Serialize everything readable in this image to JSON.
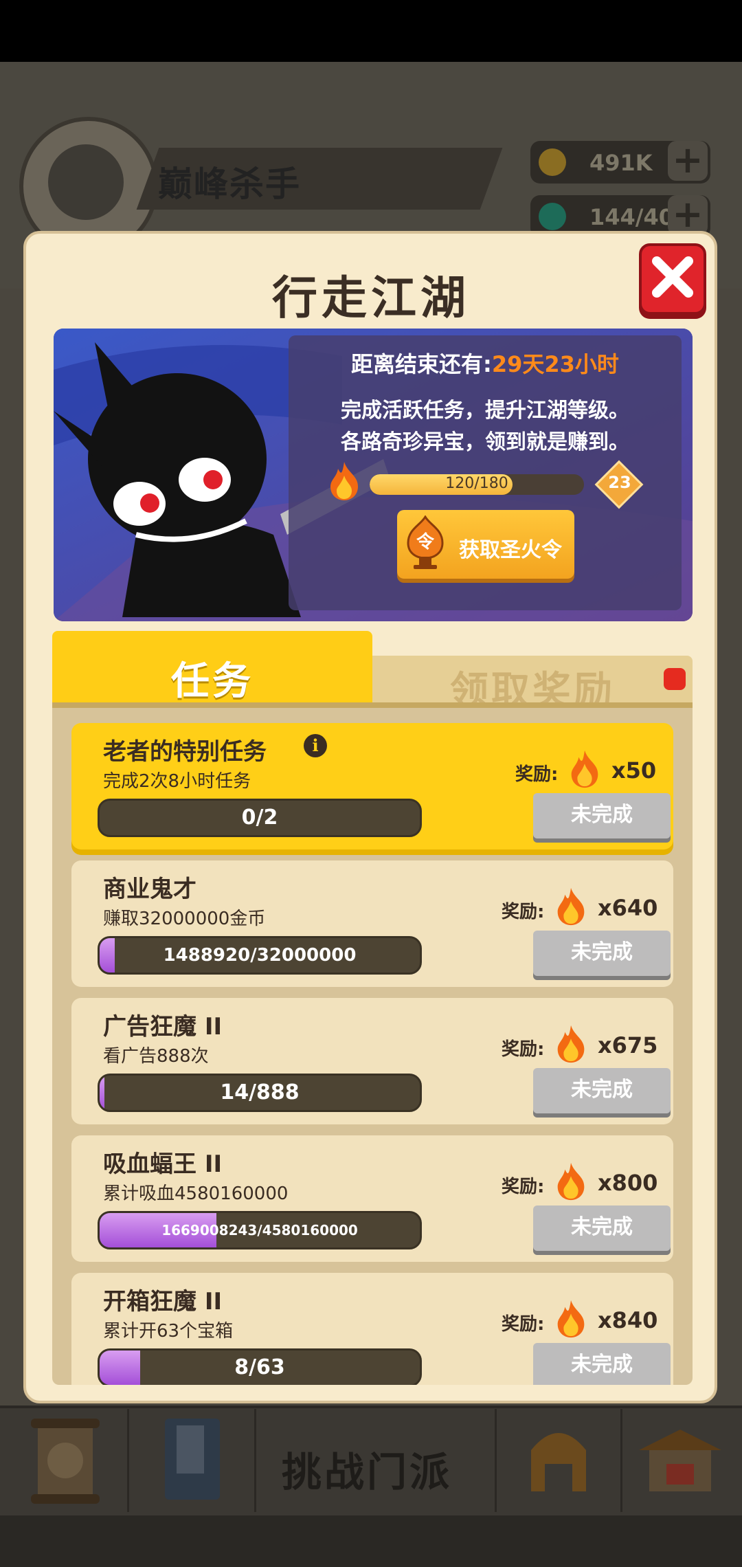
{
  "background": {
    "player_name": "巅峰杀手",
    "gold": "491K",
    "energy": "144/40",
    "plus": "+",
    "nav_challenge": "挑战门派"
  },
  "modal": {
    "title": "行走江湖",
    "banner": {
      "countdown_label": "距离结束还有:",
      "countdown_value": "29天23小时",
      "desc_line1": "完成活跃任务，提升江湖等级。",
      "desc_line2": "各路奇珍异宝，领到就是赚到。",
      "progress_text": "120/180",
      "progress_fraction": 0.667,
      "level": "23",
      "get_button_label": "获取圣火令",
      "token_char": "令"
    },
    "tabs": {
      "active": "任务",
      "inactive": "领取奖励"
    },
    "tasks": [
      {
        "title": "老者的特别任务",
        "desc": "完成2次8小时任务",
        "progress": "0/2",
        "fraction": 0.0,
        "reward_label": "奖励:",
        "reward": "x50",
        "button": "未完成"
      },
      {
        "title": "商业鬼才",
        "desc": "赚取32000000金币",
        "progress": "1488920/32000000",
        "fraction": 0.047,
        "reward_label": "奖励:",
        "reward": "x640",
        "button": "未完成"
      },
      {
        "title": "广告狂魔 II",
        "desc": "看广告888次",
        "progress": "14/888",
        "fraction": 0.016,
        "reward_label": "奖励:",
        "reward": "x675",
        "button": "未完成"
      },
      {
        "title": "吸血蝠王 II",
        "desc": "累计吸血4580160000",
        "progress": "1669008243/4580160000",
        "fraction": 0.364,
        "reward_label": "奖励:",
        "reward": "x800",
        "button": "未完成"
      },
      {
        "title": "开箱狂魔 II",
        "desc": "累计开63个宝箱",
        "progress": "8/63",
        "fraction": 0.127,
        "reward_label": "奖励:",
        "reward": "x840",
        "button": "未完成"
      }
    ]
  }
}
